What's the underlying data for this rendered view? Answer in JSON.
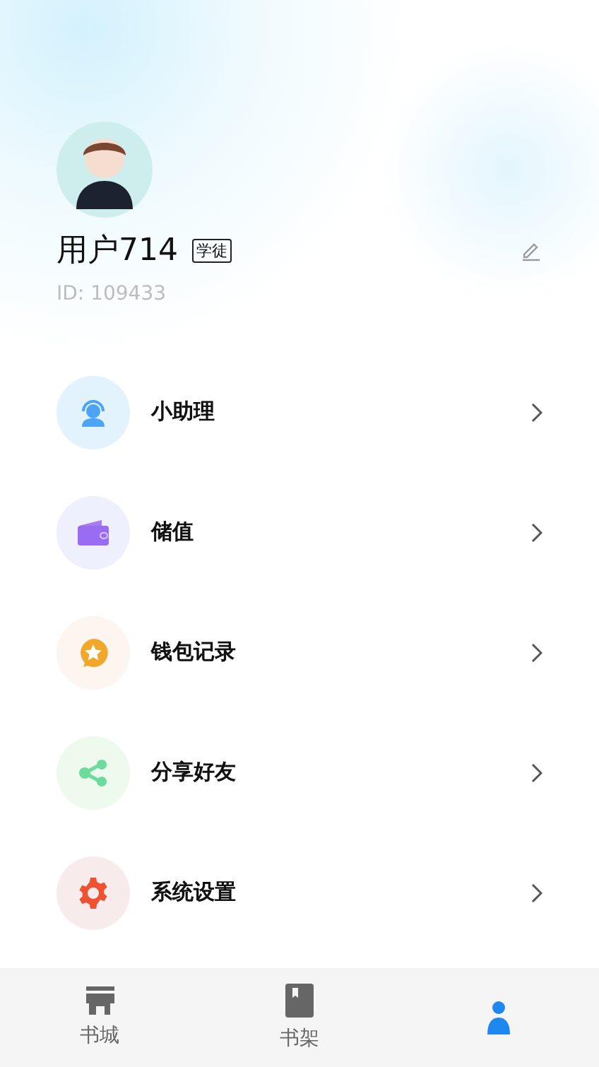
{
  "profile": {
    "name": "用户714",
    "badge": "学徒",
    "id": "ID: 109433"
  },
  "menu": [
    {
      "kind": "support",
      "label": "小助理",
      "color": "#e3f3fd"
    },
    {
      "kind": "wallet",
      "label": "储值",
      "color": "#eff0fe"
    },
    {
      "kind": "record",
      "label": "钱包记录",
      "color": "#fdf5f0"
    },
    {
      "kind": "share",
      "label": "分享好友",
      "color": "#eefaee"
    },
    {
      "kind": "settings",
      "label": "系统设置",
      "color": "#f8ebeb"
    }
  ],
  "tabs": [
    {
      "kind": "store",
      "label": "书城",
      "selected": false
    },
    {
      "kind": "shelf",
      "label": "书架",
      "selected": false
    },
    {
      "kind": "profile",
      "selected": true
    }
  ]
}
